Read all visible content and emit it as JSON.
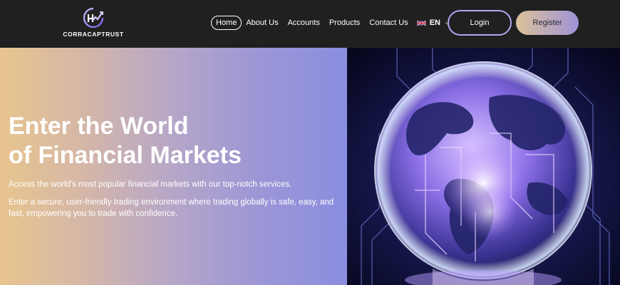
{
  "brand": {
    "name": "CORRACAPTRUST"
  },
  "nav": {
    "items": [
      {
        "label": "Home",
        "active": true
      },
      {
        "label": "About Us"
      },
      {
        "label": "Accounts"
      },
      {
        "label": "Products"
      },
      {
        "label": "Contact Us"
      }
    ],
    "language": {
      "code": "EN",
      "flag_icon": "uk-flag-icon"
    }
  },
  "auth": {
    "login_label": "Login",
    "register_label": "Register"
  },
  "hero": {
    "title_line1": "Enter the World",
    "title_line2": "of Financial Markets",
    "subtitle": "Access the world's most popular financial markets with our top-notch services.",
    "description": "Enter a secure, user-friendly trading environment where trading globally is safe, easy, and fast, empowering you to trade with confidence.",
    "image": "glowing-globe-illustration"
  },
  "colors": {
    "header_bg": "#202020",
    "accent_purple": "#b9a3f2",
    "gradient_start": "#e8c58e",
    "gradient_end": "#8a8ee0"
  }
}
